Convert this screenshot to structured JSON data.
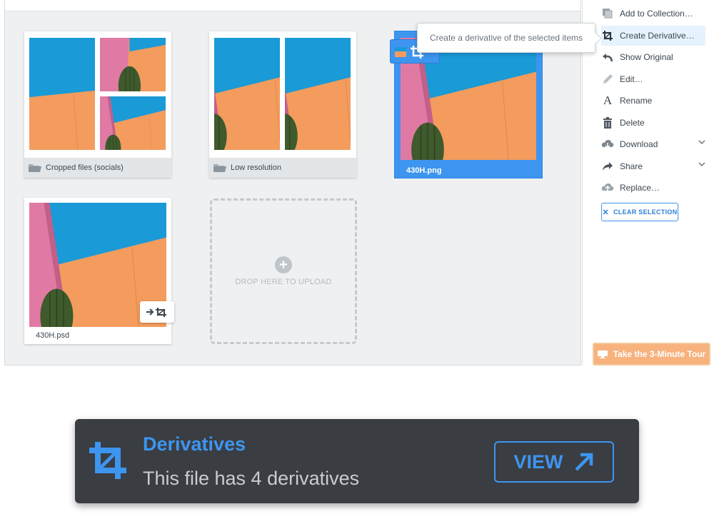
{
  "sidebar": {
    "items": [
      {
        "label": "Add to Collection…",
        "icon": "collection-icon"
      },
      {
        "label": "Create Derivative…",
        "icon": "crop-icon",
        "active": true
      },
      {
        "label": "Show Original",
        "icon": "back-arrow-icon"
      },
      {
        "label": "Edit…",
        "icon": "pencil-icon"
      },
      {
        "label": "Rename",
        "icon": "text-a-icon"
      },
      {
        "label": "Delete",
        "icon": "trash-icon"
      },
      {
        "label": "Download",
        "icon": "cloud-download-icon",
        "dropdown": true
      },
      {
        "label": "Share",
        "icon": "share-arrow-icon",
        "dropdown": true
      },
      {
        "label": "Replace…",
        "icon": "cloud-upload-icon"
      }
    ],
    "clear_selection": "CLEAR SELECTION"
  },
  "tooltip": "Create a derivative of the selected items",
  "cards": {
    "folder1": "Cropped files (socials)",
    "folder2": "Low resolution",
    "file_png": "430H.png",
    "file_psd": "430H.psd"
  },
  "dropzone": {
    "text": "DROP HERE TO UPLOAD"
  },
  "tour": {
    "label": "Take the 3-Minute Tour"
  },
  "notification": {
    "title": "Derivatives",
    "body": "This file has 4 derivatives",
    "button": "VIEW"
  },
  "colors": {
    "accent": "#3d95ef",
    "orange_wall": "#f39c5e",
    "sky": "#1a9ad6",
    "pink_wall": "#e07aa4",
    "cactus": "#3f5a2c",
    "tour_orange": "#f7b27e",
    "notice_bg": "#3a3d42"
  }
}
